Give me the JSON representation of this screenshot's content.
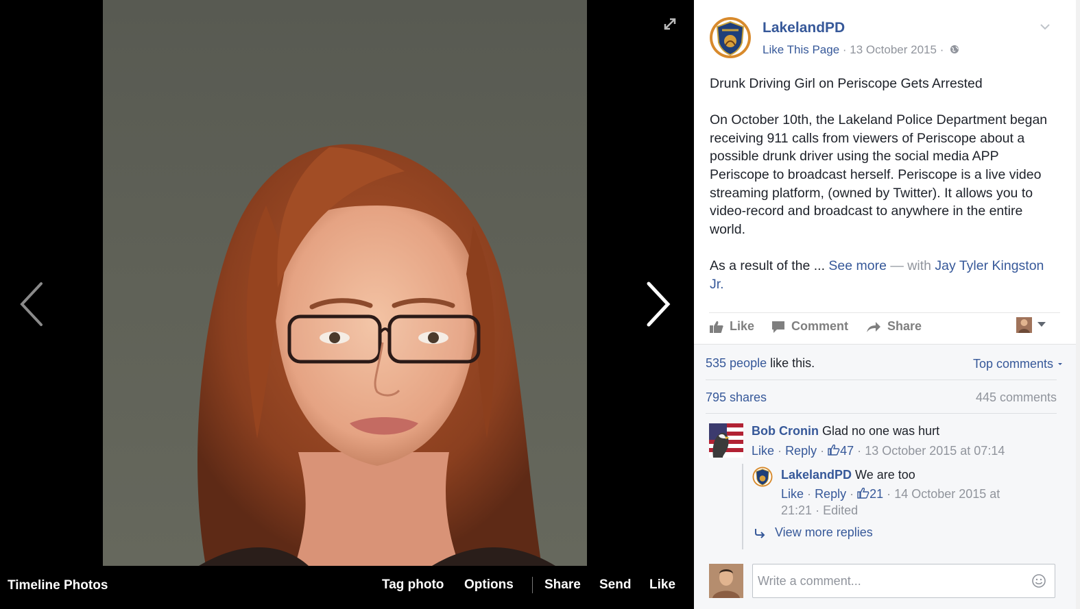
{
  "photo_viewer": {
    "album_title": "Timeline Photos",
    "actions": {
      "tag_photo": "Tag photo",
      "options": "Options",
      "share": "Share",
      "send": "Send",
      "like": "Like"
    },
    "icons": {
      "expand": "expand-icon",
      "previous": "chevron-left-icon",
      "next": "chevron-right-icon"
    }
  },
  "post": {
    "page_name": "LakelandPD",
    "like_page_label": "Like This Page",
    "date": "13 October 2015",
    "separator": "·",
    "title": "Drunk Driving Girl on Periscope Gets Arrested",
    "body": "On October 10th, the Lakeland Police Department began receiving 911 calls from viewers of Periscope about a possible drunk driver using the social media APP Periscope to broadcast herself. Periscope is a live video streaming platform, (owned by Twitter). It allows you to video-record and broadcast to anywhere in the entire world.",
    "excerpt_start": "As a result of the ...",
    "see_more": "See more",
    "with_label": "— with",
    "tagged_person": "Jay Tyler Kingston Jr.",
    "actions": {
      "like": "Like",
      "comment": "Comment",
      "share": "Share"
    }
  },
  "feedback": {
    "likes_link": "535 people",
    "likes_suffix": "like this.",
    "sort_label": "Top comments",
    "shares": "795 shares",
    "comments_count": "445 comments",
    "comments": [
      {
        "author": "Bob Cronin",
        "text": "Glad no one was hurt",
        "like": "Like",
        "reply": "Reply",
        "like_count": "47",
        "timestamp": "13 October 2015 at 07:14",
        "replies": [
          {
            "author": "LakelandPD",
            "text": "We are too",
            "like": "Like",
            "reply": "Reply",
            "like_count": "21",
            "timestamp": "14 October 2015 at 21:21",
            "edited": "Edited"
          }
        ]
      }
    ],
    "view_more_replies": "View more replies",
    "composer_placeholder": "Write a comment..."
  },
  "colors": {
    "link_blue": "#365899",
    "muted_gray": "#90949c",
    "feedback_bg": "#f6f7f9",
    "viewer_bg": "#000000"
  }
}
